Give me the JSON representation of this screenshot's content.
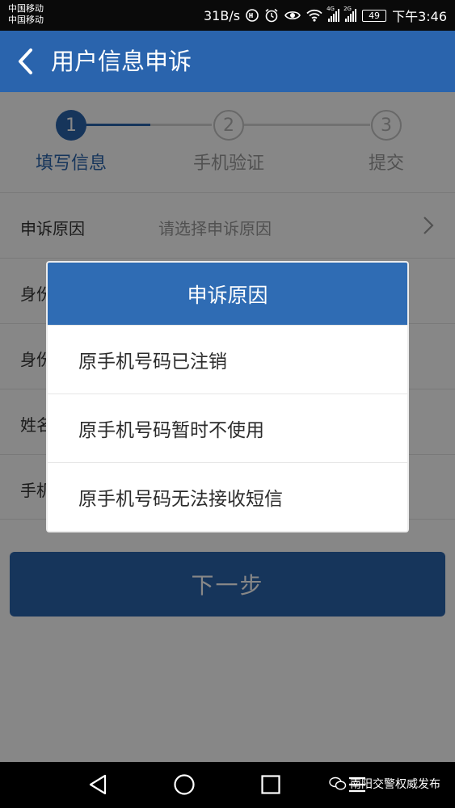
{
  "status_bar": {
    "carrier_1": "中国移动",
    "carrier_2": "中国移动",
    "speed": "31B/s",
    "net_1": "4G",
    "net_2": "2G",
    "battery": "49",
    "time": "下午3:46",
    "icons": [
      "hd-icon",
      "alarm-icon",
      "eye-icon",
      "wifi-icon",
      "signal-icon",
      "signal-icon",
      "battery-icon"
    ]
  },
  "header": {
    "title": "用户信息申诉",
    "back_icon": "chevron-left-icon",
    "color": "#2a64ad"
  },
  "stepper": {
    "steps": [
      {
        "number": "1",
        "label": "填写信息",
        "active": true
      },
      {
        "number": "2",
        "label": "手机验证",
        "active": false
      },
      {
        "number": "3",
        "label": "提交",
        "active": false
      }
    ]
  },
  "form": {
    "rows": [
      {
        "label": "申诉原因",
        "value": "请选择申诉原因"
      },
      {
        "label": "身份",
        "value": ""
      },
      {
        "label": "身份",
        "value": ""
      },
      {
        "label": "姓名",
        "value": ""
      },
      {
        "label": "手机",
        "value": ""
      }
    ],
    "next_button": "下一步"
  },
  "dialog": {
    "title": "申诉原因",
    "options": [
      "原手机号码已注销",
      "原手机号码暂时不使用",
      "原手机号码无法接收短信"
    ]
  },
  "nav_bar": {
    "icons": [
      "back-triangle-icon",
      "home-circle-icon",
      "recents-square-icon",
      "menu-icon"
    ],
    "watermark": "南阳交警权威发布"
  }
}
